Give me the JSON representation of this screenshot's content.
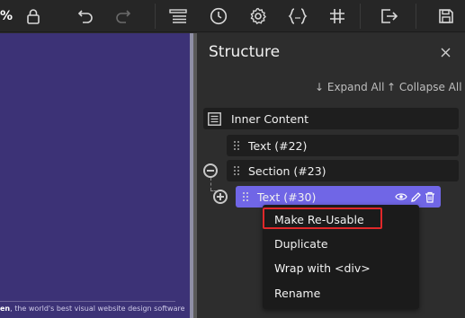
{
  "toolbar": {
    "zoom_label": "%",
    "icons": [
      "lock-icon",
      "undo-icon",
      "redo-icon",
      "list-icon",
      "clock-icon",
      "gear-icon",
      "code-braces-icon",
      "hash-icon",
      "exit-icon",
      "save-icon"
    ]
  },
  "canvas": {
    "footer_bold": "en",
    "footer_text": ", the world's best visual website design software"
  },
  "structure": {
    "title": "Structure",
    "expand_all": "↓ Expand All",
    "collapse_all": "↑ Collapse All",
    "nodes": [
      {
        "label": "Inner Content"
      },
      {
        "label": "Text (#22)"
      },
      {
        "label": "Section (#23)"
      },
      {
        "label": "Text (#30)"
      }
    ]
  },
  "context_menu": {
    "items": [
      {
        "label": "Make Re-Usable"
      },
      {
        "label": "Duplicate"
      },
      {
        "label": "Wrap with <div>"
      },
      {
        "label": "Rename"
      }
    ]
  },
  "colors": {
    "accent": "#7066e6",
    "canvas_bg": "#3c3276",
    "highlight": "#e0282a"
  }
}
